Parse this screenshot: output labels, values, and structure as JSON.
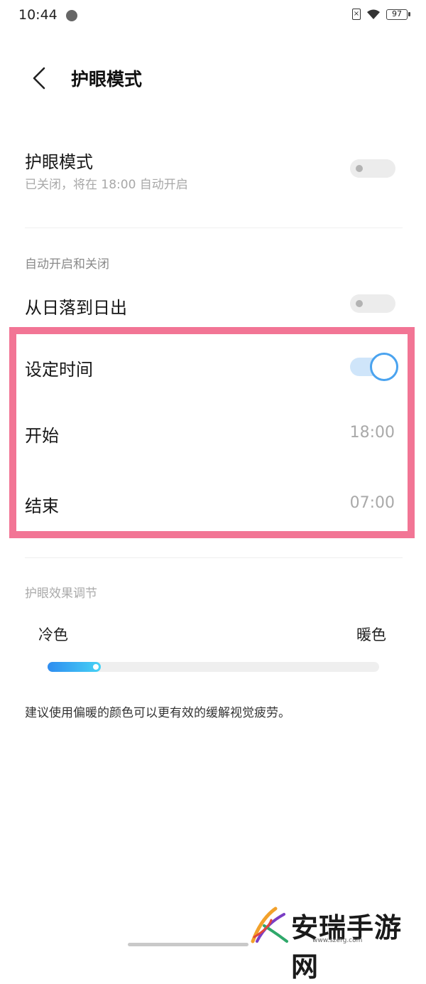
{
  "status_bar": {
    "time": "10:44",
    "battery": "97",
    "icons": [
      "compass-icon",
      "sim-off-icon",
      "wifi-icon",
      "battery-icon"
    ]
  },
  "header": {
    "title": "护眼模式",
    "back_icon": "back-chevron-icon"
  },
  "eye_mode": {
    "title": "护眼模式",
    "subtitle": "已关闭，将在 18:00 自动开启",
    "enabled": false
  },
  "auto_section": {
    "label": "自动开启和关闭",
    "sunset_title": "从日落到日出",
    "sunset_enabled": false,
    "custom_title": "设定时间",
    "custom_enabled": true,
    "start_label": "开始",
    "start_value": "18:00",
    "end_label": "结束",
    "end_value": "07:00"
  },
  "effect_section": {
    "label": "护眼效果调节",
    "cool_label": "冷色",
    "warm_label": "暖色",
    "level": 0.16,
    "note": "建议使用偏暖的颜色可以更有效的缓解视觉疲劳。"
  },
  "watermark": {
    "text": "安瑞手游网",
    "url": "www.szerg.com"
  },
  "colors": {
    "accent": "#4aa3ef",
    "highlight": "#f27595"
  }
}
